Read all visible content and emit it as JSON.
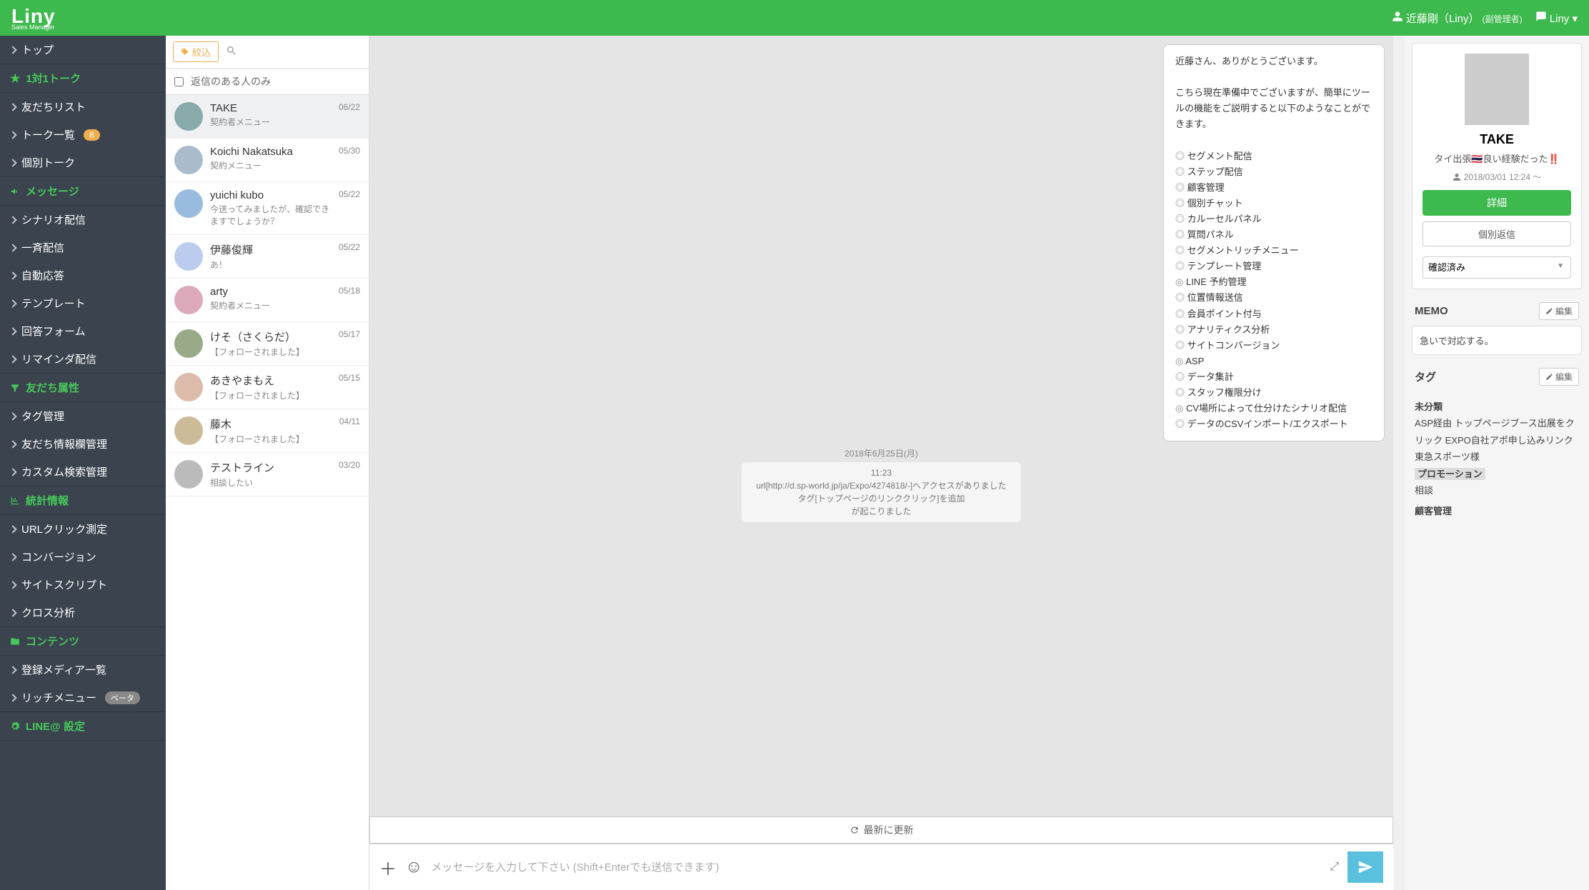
{
  "header": {
    "logo": "Liny",
    "logo_sub": "Sales Manager",
    "user_name": "近藤剛（Liny）",
    "user_role": "(副管理者)",
    "chat_label": "Liny"
  },
  "sidebar": {
    "items": [
      {
        "type": "item",
        "label": "トップ"
      },
      {
        "type": "section",
        "label": "1対1トーク",
        "icon": "star"
      },
      {
        "type": "item",
        "label": "友だちリスト"
      },
      {
        "type": "item",
        "label": "トーク一覧",
        "badge": "8"
      },
      {
        "type": "item",
        "label": "個別トーク"
      },
      {
        "type": "section",
        "label": "メッセージ",
        "icon": "megaphone"
      },
      {
        "type": "item",
        "label": "シナリオ配信"
      },
      {
        "type": "item",
        "label": "一斉配信"
      },
      {
        "type": "item",
        "label": "自動応答"
      },
      {
        "type": "item",
        "label": "テンプレート"
      },
      {
        "type": "item",
        "label": "回答フォーム"
      },
      {
        "type": "item",
        "label": "リマインダ配信"
      },
      {
        "type": "section",
        "label": "友だち属性",
        "icon": "filter"
      },
      {
        "type": "item",
        "label": "タグ管理"
      },
      {
        "type": "item",
        "label": "友だち情報欄管理"
      },
      {
        "type": "item",
        "label": "カスタム検索管理"
      },
      {
        "type": "section",
        "label": "統計情報",
        "icon": "chart"
      },
      {
        "type": "item",
        "label": "URLクリック測定"
      },
      {
        "type": "item",
        "label": "コンバージョン"
      },
      {
        "type": "item",
        "label": "サイトスクリプト"
      },
      {
        "type": "item",
        "label": "クロス分析"
      },
      {
        "type": "section",
        "label": "コンテンツ",
        "icon": "folder"
      },
      {
        "type": "item",
        "label": "登録メディア一覧"
      },
      {
        "type": "item",
        "label": "リッチメニュー",
        "beta": "ベータ"
      },
      {
        "type": "section",
        "label": "LINE@ 設定",
        "icon": "gear"
      }
    ]
  },
  "filter": {
    "button_label": "絞込",
    "reply_only_label": "返信のある人のみ"
  },
  "talklist": [
    {
      "name": "TAKE",
      "preview": "契約者メニュー",
      "date": "06/22",
      "active": true
    },
    {
      "name": "Koichi Nakatsuka",
      "preview": "契約メニュー",
      "date": "05/30"
    },
    {
      "name": "yuichi kubo",
      "preview": "今送ってみましたが、確認できますでしょうか？",
      "date": "05/22"
    },
    {
      "name": "伊藤俊輝",
      "preview": "あ！",
      "date": "05/22"
    },
    {
      "name": "arty",
      "preview": "契約者メニュー",
      "date": "05/18"
    },
    {
      "name": "けそ（さくらだ）",
      "preview": "【フォローされました】",
      "date": "05/17"
    },
    {
      "name": "あきやまもえ",
      "preview": "【フォローされました】",
      "date": "05/15"
    },
    {
      "name": "藤木",
      "preview": "【フォローされました】",
      "date": "04/11"
    },
    {
      "name": "テストライン",
      "preview": "相談したい",
      "date": "03/20"
    }
  ],
  "chat": {
    "message_intro": "近藤さん、ありがとうございます。",
    "message_body": "こちら現在準備中でございますが、簡単にツールの機能をご説明すると以下のようなことができます。",
    "features": [
      "セグメント配信",
      "ステップ配信",
      "顧客管理",
      "個別チャット",
      "カルーセルパネル",
      "質問パネル",
      "セグメントリッチメニュー",
      "テンプレート管理",
      "LINE 予約管理",
      "位置情報送信",
      "会員ポイント付与",
      "アナリティクス分析",
      "サイトコンバージョン",
      "ASP",
      "データ集計",
      "スタッフ権限分け",
      "CV場所によって仕分けたシナリオ配信",
      "データのCSVインポート/エクスポート"
    ],
    "date_label": "2018年6月25日(月)",
    "event_time": "11:23",
    "event_line1": "url[http://d.sp-world.jp/ja/Expo/4274818/-]へアクセスがありました",
    "event_line2": "タグ[トップページのリンククリック]を追加",
    "event_line3": "が起こりました",
    "refresh_label": "最新に更新",
    "input_placeholder": "メッセージを入力して下さい (Shift+Enterでも送信できます)"
  },
  "detail": {
    "name": "TAKE",
    "status": "タイ出張🇹🇭良い経験だった‼️",
    "date": "2018/03/01 12:24 〜",
    "btn_detail": "詳細",
    "btn_reply": "個別返信",
    "select_value": "確認済み",
    "memo_title": "MEMO",
    "memo_edit": "編集",
    "memo_body": "急いで対応する。",
    "tag_title": "タグ",
    "tag_edit": "編集",
    "tag_group1_title": "未分類",
    "tag_group1_body": "ASP経由 トップページブース出展をクリック EXPO自社アポ申し込みリンク 東急スポーツ様",
    "tag_group2_title": "プロモーション",
    "tag_group2_body": "相談",
    "tag_group3_title": "顧客管理"
  }
}
